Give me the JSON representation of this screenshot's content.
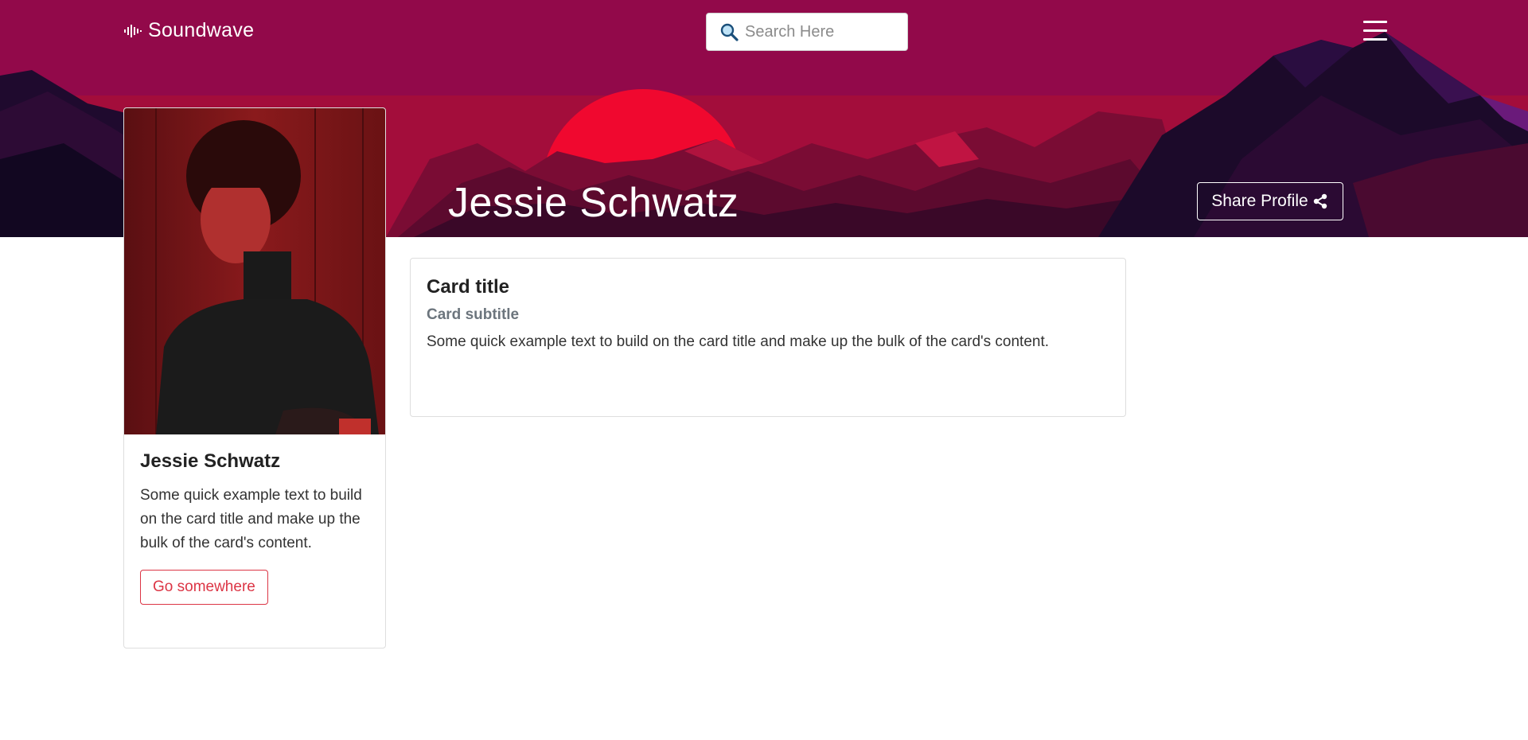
{
  "nav": {
    "brand": "Soundwave",
    "search_placeholder": "Search Here"
  },
  "hero": {
    "name": "Jessie Schwatz",
    "share_label": "Share Profile"
  },
  "profile_card": {
    "title": "Jessie Schwatz",
    "text": "Some quick example text to build on the card title and make up the bulk of the card's content.",
    "button_label": "Go somewhere"
  },
  "info_card": {
    "title": "Card title",
    "subtitle": "Card subtitle",
    "text": "Some quick example text to build on the card title and make up the bulk of the card's content."
  },
  "icons": {
    "brand": "soundwave-icon",
    "search": "magnifying-glass-icon",
    "menu": "hamburger-menu-icon",
    "share": "share-icon"
  },
  "colors": {
    "hero": "#8e0a45",
    "sun": "#f0082f",
    "accent": "#dc3545"
  }
}
